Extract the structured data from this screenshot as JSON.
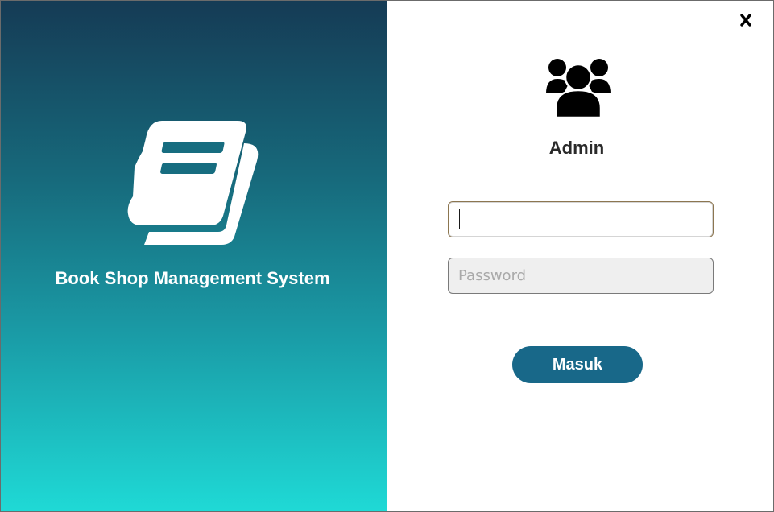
{
  "app": {
    "title": "Book Shop Management System"
  },
  "login": {
    "role_label": "Admin",
    "username": {
      "value": "",
      "placeholder": ""
    },
    "password": {
      "value": "",
      "placeholder": "Password"
    },
    "submit_label": "Masuk"
  },
  "icons": {
    "logo": "book-icon",
    "user": "users-group-icon",
    "close": "close-icon"
  },
  "colors": {
    "gradient_top": "#153b55",
    "gradient_bottom": "#1fdad6",
    "button": "#186889",
    "text_light": "#ffffff",
    "text_dark": "#2a2a2a"
  }
}
